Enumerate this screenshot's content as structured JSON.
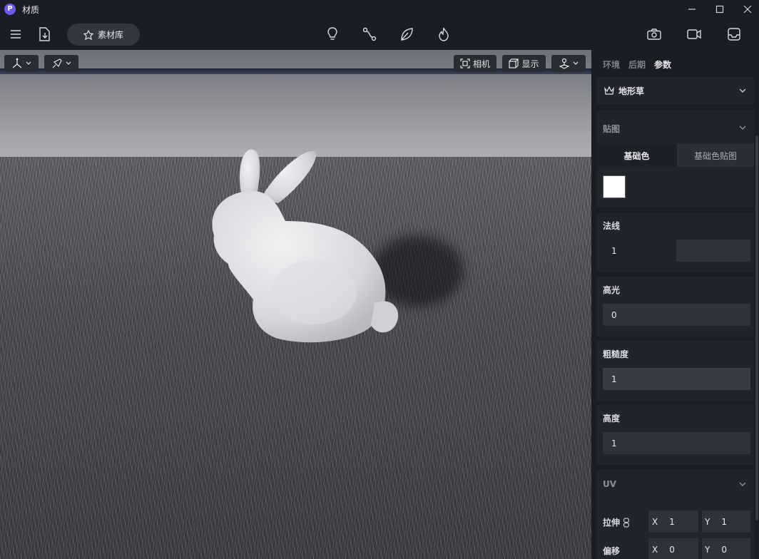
{
  "window": {
    "app_logo": "P",
    "title": "材质",
    "minimize_icon": "minimize-icon",
    "maximize_icon": "maximize-icon",
    "close_icon": "close-icon"
  },
  "toolbar": {
    "material_library_label": "素材库",
    "icons": [
      "menu-icon",
      "import-file-icon",
      "lightbulb-icon",
      "node-graph-icon",
      "leaf-icon",
      "fire-icon",
      "camera-icon",
      "video-icon",
      "inbox-icon"
    ]
  },
  "viewport": {
    "camera_label": "相机",
    "display_label": "显示"
  },
  "panel": {
    "tabs": [
      {
        "label": "环境",
        "active": false
      },
      {
        "label": "后期",
        "active": false
      },
      {
        "label": "参数",
        "active": true
      }
    ],
    "material_select": {
      "value": "地形草"
    },
    "texture_section": {
      "title": "贴图",
      "subtabs": [
        {
          "label": "基础色",
          "active": true
        },
        {
          "label": "基础色贴图",
          "active": false
        }
      ],
      "base_color": "#ffffff"
    },
    "normal": {
      "title": "法线",
      "value": "1"
    },
    "specular": {
      "title": "高光",
      "value": "0"
    },
    "roughness": {
      "title": "粗糙度",
      "value": "1"
    },
    "height": {
      "title": "高度",
      "value": "1"
    },
    "uv_section": {
      "title": "UV",
      "stretch": {
        "label": "拉伸",
        "x_label": "X",
        "x": "1",
        "y_label": "Y",
        "y": "1"
      },
      "offset": {
        "label": "偏移",
        "x_label": "X",
        "x": "0",
        "y_label": "Y",
        "y": "0"
      }
    }
  }
}
